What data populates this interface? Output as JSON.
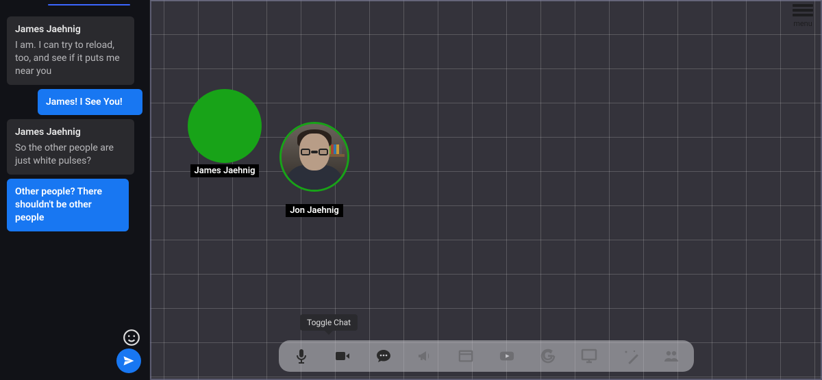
{
  "menu": {
    "label": "menu"
  },
  "chat": {
    "messages": [
      {
        "sender": "James Jaehnig",
        "body": "I am. I can try to reload, too, and see if it puts me near you",
        "kind": "left"
      },
      {
        "body": "James! I See You!",
        "kind": "right"
      },
      {
        "sender": "James Jaehnig",
        "body": "So the other people are just white pulses?",
        "kind": "left"
      },
      {
        "body": "Other people? There shouldn't be other people",
        "kind": "highlight"
      }
    ]
  },
  "avatars": {
    "a1": {
      "label": "James Jaehnig"
    },
    "a2": {
      "label": "Jon Jaehnig"
    }
  },
  "tooltip": {
    "toggle_chat": "Toggle Chat"
  },
  "toolbar": {
    "items": [
      {
        "name": "microphone",
        "dim": false
      },
      {
        "name": "video",
        "dim": false
      },
      {
        "name": "chat",
        "dim": false
      },
      {
        "name": "megaphone",
        "dim": true
      },
      {
        "name": "window",
        "dim": true
      },
      {
        "name": "youtube",
        "dim": true
      },
      {
        "name": "google",
        "dim": true
      },
      {
        "name": "screenshare",
        "dim": true
      },
      {
        "name": "magic",
        "dim": true
      },
      {
        "name": "people",
        "dim": true
      }
    ]
  }
}
